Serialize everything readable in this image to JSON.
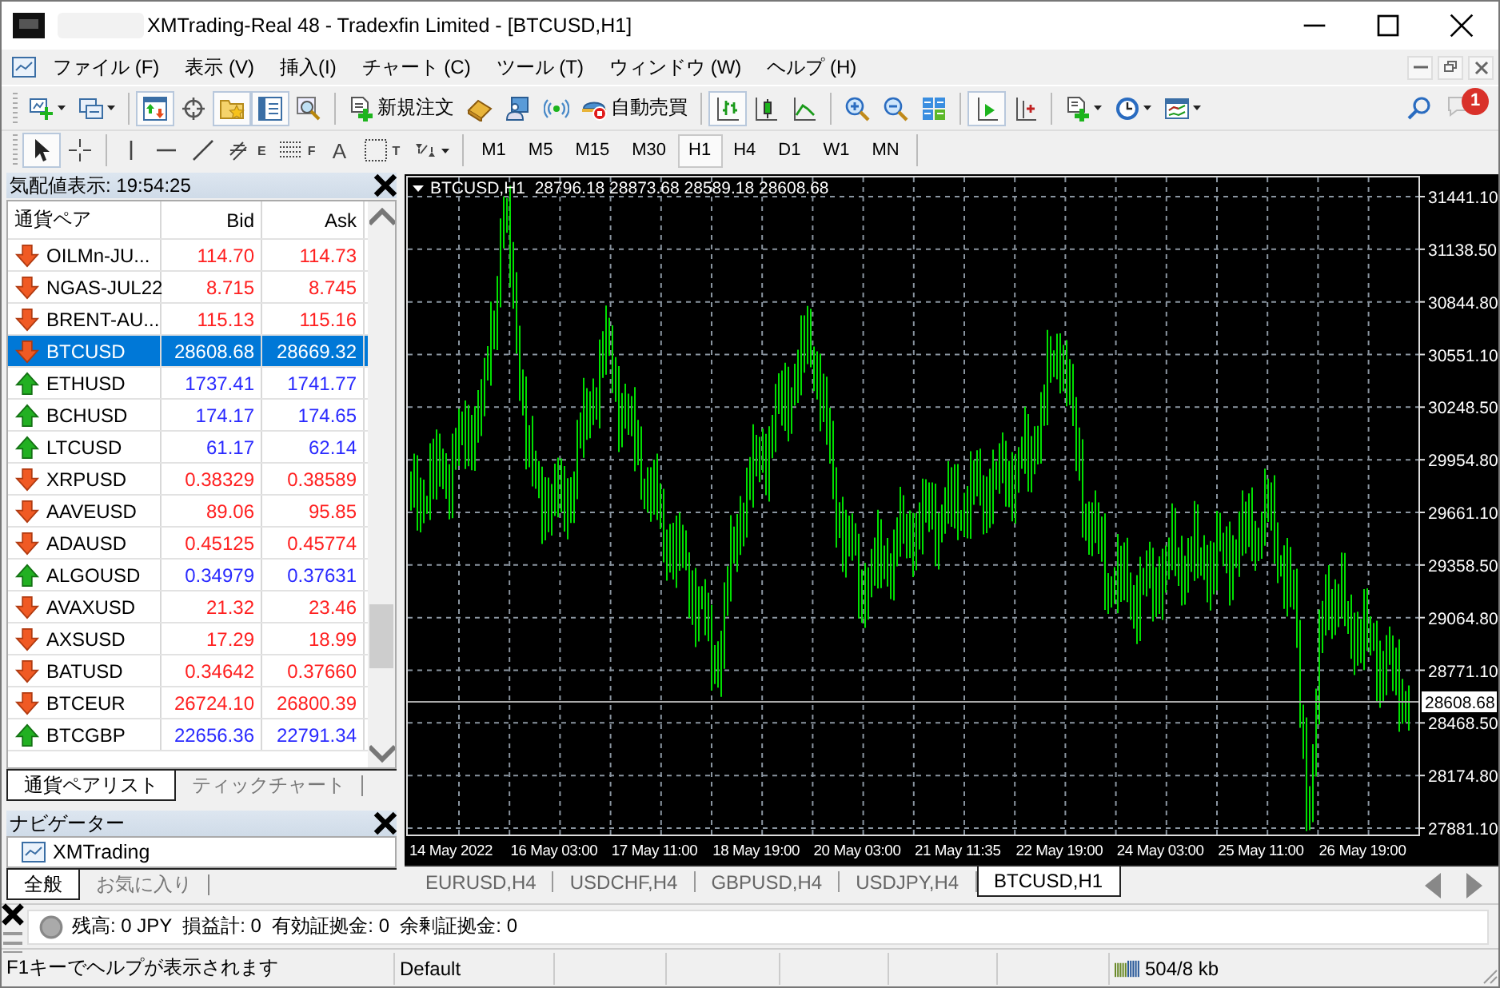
{
  "window": {
    "title": "XMTrading-Real 48 - Tradexfin Limited - [BTCUSD,H1]"
  },
  "menu": [
    "ファイル (F)",
    "表示 (V)",
    "挿入(I)",
    "チャート (C)",
    "ツール (T)",
    "ウィンドウ (W)",
    "ヘルプ (H)"
  ],
  "toolbar": [
    {
      "kind": "new_chart",
      "selected": false,
      "dropdown": true
    },
    {
      "kind": "profiles",
      "selected": false,
      "dropdown": true
    },
    {
      "kind": "sep"
    },
    {
      "kind": "market_watch",
      "selected": true
    },
    {
      "kind": "data_window",
      "selected": false
    },
    {
      "kind": "navigator",
      "selected": true
    },
    {
      "kind": "terminal",
      "selected": true
    },
    {
      "kind": "tester",
      "selected": false
    },
    {
      "kind": "sep"
    },
    {
      "kind": "new_order",
      "selected": false,
      "label": "新規注文"
    },
    {
      "kind": "editor",
      "selected": false
    },
    {
      "kind": "community",
      "selected": false
    },
    {
      "kind": "signals",
      "selected": false
    },
    {
      "kind": "autotrading",
      "selected": false,
      "label": "自動売買"
    },
    {
      "kind": "sep"
    },
    {
      "kind": "bar_chart",
      "selected": true
    },
    {
      "kind": "candles",
      "selected": false
    },
    {
      "kind": "line_chart",
      "selected": false
    },
    {
      "kind": "sep"
    },
    {
      "kind": "zoom_in",
      "selected": false
    },
    {
      "kind": "zoom_out",
      "selected": false
    },
    {
      "kind": "tile",
      "selected": false
    },
    {
      "kind": "sep"
    },
    {
      "kind": "autoscroll",
      "selected": true
    },
    {
      "kind": "shift",
      "selected": false
    },
    {
      "kind": "sep"
    },
    {
      "kind": "template",
      "selected": false,
      "dropdown": true
    },
    {
      "kind": "periods",
      "selected": false,
      "dropdown": true
    },
    {
      "kind": "indicators",
      "selected": false,
      "dropdown": true
    }
  ],
  "notifications": {
    "count": "1"
  },
  "drawing_tools": [
    {
      "kind": "cursor",
      "selected": true
    },
    {
      "kind": "crosshair",
      "selected": false
    },
    {
      "kind": "sep"
    },
    {
      "kind": "vline",
      "selected": false
    },
    {
      "kind": "hline",
      "selected": false
    },
    {
      "kind": "trendline",
      "selected": false
    },
    {
      "kind": "channel",
      "selected": false,
      "glyph": "E"
    },
    {
      "kind": "fibo",
      "selected": false,
      "glyph": "F"
    },
    {
      "kind": "text",
      "selected": false,
      "glyph": "A"
    },
    {
      "kind": "label",
      "selected": false,
      "glyph": "T"
    },
    {
      "kind": "arrows",
      "selected": false,
      "dropdown": true
    }
  ],
  "timeframes": [
    {
      "label": "M1",
      "selected": false
    },
    {
      "label": "M5",
      "selected": false
    },
    {
      "label": "M15",
      "selected": false
    },
    {
      "label": "M30",
      "selected": false
    },
    {
      "label": "H1",
      "selected": true
    },
    {
      "label": "H4",
      "selected": false
    },
    {
      "label": "D1",
      "selected": false
    },
    {
      "label": "W1",
      "selected": false
    },
    {
      "label": "MN",
      "selected": false
    }
  ],
  "market_watch": {
    "title": "気配値表示: 19:54:25",
    "columns": [
      "通貨ペア",
      "Bid",
      "Ask"
    ],
    "rows": [
      {
        "symbol": "OILMn-JU...",
        "bid": "114.70",
        "ask": "114.73",
        "rising": false,
        "selected": false
      },
      {
        "symbol": "NGAS-JUL22",
        "bid": "8.715",
        "ask": "8.745",
        "rising": false,
        "selected": false
      },
      {
        "symbol": "BRENT-AU...",
        "bid": "115.13",
        "ask": "115.16",
        "rising": false,
        "selected": false
      },
      {
        "symbol": "BTCUSD",
        "bid": "28608.68",
        "ask": "28669.32",
        "rising": false,
        "selected": true
      },
      {
        "symbol": "ETHUSD",
        "bid": "1737.41",
        "ask": "1741.77",
        "rising": true,
        "selected": false
      },
      {
        "symbol": "BCHUSD",
        "bid": "174.17",
        "ask": "174.65",
        "rising": true,
        "selected": false
      },
      {
        "symbol": "LTCUSD",
        "bid": "61.17",
        "ask": "62.14",
        "rising": true,
        "selected": false
      },
      {
        "symbol": "XRPUSD",
        "bid": "0.38329",
        "ask": "0.38589",
        "rising": false,
        "selected": false
      },
      {
        "symbol": "AAVEUSD",
        "bid": "89.06",
        "ask": "95.85",
        "rising": false,
        "selected": false
      },
      {
        "symbol": "ADAUSD",
        "bid": "0.45125",
        "ask": "0.45774",
        "rising": false,
        "selected": false
      },
      {
        "symbol": "ALGOUSD",
        "bid": "0.34979",
        "ask": "0.37631",
        "rising": true,
        "selected": false
      },
      {
        "symbol": "AVAXUSD",
        "bid": "21.32",
        "ask": "23.46",
        "rising": false,
        "selected": false
      },
      {
        "symbol": "AXSUSD",
        "bid": "17.29",
        "ask": "18.99",
        "rising": false,
        "selected": false
      },
      {
        "symbol": "BATUSD",
        "bid": "0.34642",
        "ask": "0.37660",
        "rising": false,
        "selected": false
      },
      {
        "symbol": "BTCEUR",
        "bid": "26724.10",
        "ask": "26800.39",
        "rising": false,
        "selected": false
      },
      {
        "symbol": "BTCGBP",
        "bid": "22656.36",
        "ask": "22791.34",
        "rising": true,
        "selected": false
      }
    ],
    "tabs": [
      {
        "label": "通貨ペアリスト",
        "selected": true
      },
      {
        "label": "ティックチャート",
        "selected": false
      }
    ]
  },
  "navigator": {
    "title": "ナビゲーター",
    "items": [
      "XMTrading"
    ],
    "tabs": [
      {
        "label": "全般",
        "selected": true
      },
      {
        "label": "お気に入り",
        "selected": false
      }
    ]
  },
  "chart": {
    "symbol": "BTCUSD,H1",
    "ohlc": "28796.18 28873.68 28589.18 28608.68",
    "price_labels": [
      "31441.10",
      "31138.50",
      "30844.80",
      "30551.10",
      "30248.50",
      "29954.80",
      "29661.10",
      "29358.50",
      "29064.80",
      "28771.10",
      "28468.50",
      "28174.80",
      "27881.10"
    ],
    "current_price": "28608.68",
    "time_labels": [
      "14 May 2022",
      "16 May 03:00",
      "17 May 11:00",
      "18 May 19:00",
      "20 May 03:00",
      "21 May 11:35",
      "22 May 19:00",
      "24 May 03:00",
      "25 May 11:00",
      "26 May 19:00"
    ]
  },
  "chart_tabs": [
    {
      "label": "EURUSD,H4",
      "selected": false
    },
    {
      "label": "USDCHF,H4",
      "selected": false
    },
    {
      "label": "GBPUSD,H4",
      "selected": false
    },
    {
      "label": "USDJPY,H4",
      "selected": false
    },
    {
      "label": "BTCUSD,H1",
      "selected": true
    }
  ],
  "terminal": {
    "summary": "残高: 0 JPY  損益計: 0  有効証拠金: 0  余剰証拠金: 0"
  },
  "status_bar": {
    "help": "F1キーでヘルプが表示されます",
    "profile": "Default",
    "traffic": "504/8 kb"
  }
}
